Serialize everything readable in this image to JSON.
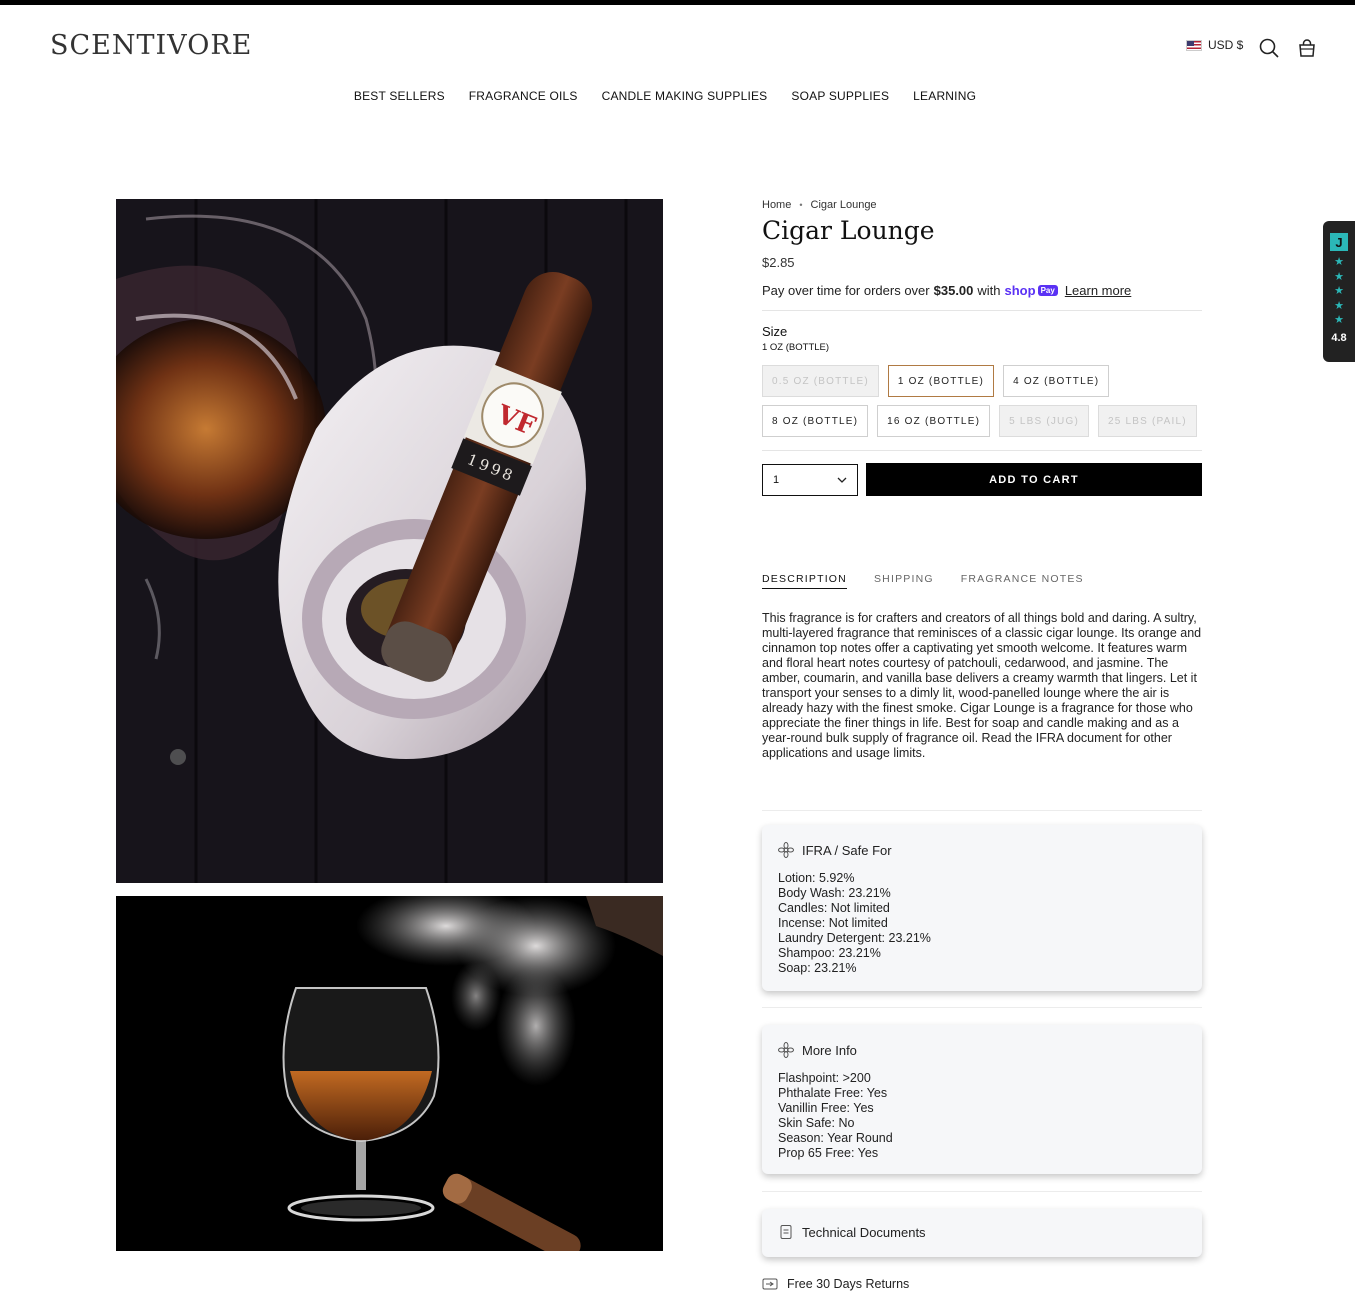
{
  "brand": {
    "logo_text": "SCENTIVORE"
  },
  "header": {
    "currency_label": "USD $",
    "icons": {
      "search": "search-icon",
      "cart": "shopping-bag-icon"
    }
  },
  "nav": {
    "items": [
      {
        "label": "BEST SELLERS"
      },
      {
        "label": "FRAGRANCE OILS"
      },
      {
        "label": "CANDLE MAKING SUPPLIES"
      },
      {
        "label": "SOAP SUPPLIES"
      },
      {
        "label": "LEARNING"
      }
    ]
  },
  "gallery": {
    "images": [
      {
        "semantic": "cigar-on-ashtray-photo"
      },
      {
        "semantic": "brandy-glass-smoke-photo"
      }
    ]
  },
  "product": {
    "breadcrumb": {
      "home": "Home",
      "current": "Cigar Lounge"
    },
    "title": "Cigar Lounge",
    "price": "$2.85",
    "shoppay": {
      "prefix": "Pay over time for orders over",
      "amount": "$35.00",
      "with": "with",
      "brand": "shop",
      "badge": "Pay",
      "link": "Learn more"
    },
    "size": {
      "label": "Size",
      "selected": "1 OZ (BOTTLE)",
      "options": [
        {
          "label": "0.5 OZ (BOTTLE)",
          "state": "disabled"
        },
        {
          "label": "1 OZ (BOTTLE)",
          "state": "selected"
        },
        {
          "label": "4 OZ (BOTTLE)",
          "state": "available"
        },
        {
          "label": "8 OZ (BOTTLE)",
          "state": "available"
        },
        {
          "label": "16 OZ (BOTTLE)",
          "state": "available"
        },
        {
          "label": "5 LBS (JUG)",
          "state": "disabled"
        },
        {
          "label": "25 LBS (PAIL)",
          "state": "disabled"
        }
      ]
    },
    "quantity": "1",
    "add_to_cart": "ADD TO CART"
  },
  "tabs": {
    "items": [
      {
        "label": "DESCRIPTION",
        "active": true
      },
      {
        "label": "SHIPPING",
        "active": false
      },
      {
        "label": "FRAGRANCE NOTES",
        "active": false
      }
    ]
  },
  "description": "This fragrance is for crafters and creators of all things bold and daring. A sultry, multi-layered fragrance that reminisces of a classic cigar lounge. Its orange and cinnamon top notes offer a captivating yet smooth welcome. It features warm and floral heart notes courtesy of patchouli, cedarwood, and jasmine. The amber, coumarin, and vanilla base delivers a creamy warmth that lingers. Let it transport your senses to a dimly lit, wood-panelled lounge where the air is already hazy with the finest smoke. Cigar Lounge is a fragrance for those who appreciate the finer things in life. Best for soap and candle making and as a year-round bulk supply of fragrance oil. Read the IFRA document for other applications and usage limits.",
  "ifra_card": {
    "title": "IFRA / Safe For",
    "lines": [
      "Lotion: 5.92%",
      "Body Wash: 23.21%",
      "Candles: Not limited",
      "Incense: Not limited",
      "Laundry Detergent: 23.21%",
      "Shampoo: 23.21%",
      "Soap: 23.21%"
    ]
  },
  "more_info_card": {
    "title": "More Info",
    "lines": [
      "Flashpoint: >200",
      "Phthalate Free: Yes",
      "Vanillin Free: Yes",
      "Skin Safe: No",
      "Season: Year Round",
      "Prop 65 Free: Yes"
    ]
  },
  "tech_docs": {
    "title": "Technical Documents"
  },
  "returns": {
    "label": "Free 30 Days Returns"
  },
  "reviews_widget": {
    "logo": "J",
    "score": "4.8",
    "stars": 5,
    "accent": "#2bb7b7"
  },
  "colors": {
    "accent_selected": "#b07a43",
    "button": "#000000",
    "shoppay": "#5a31f4"
  }
}
